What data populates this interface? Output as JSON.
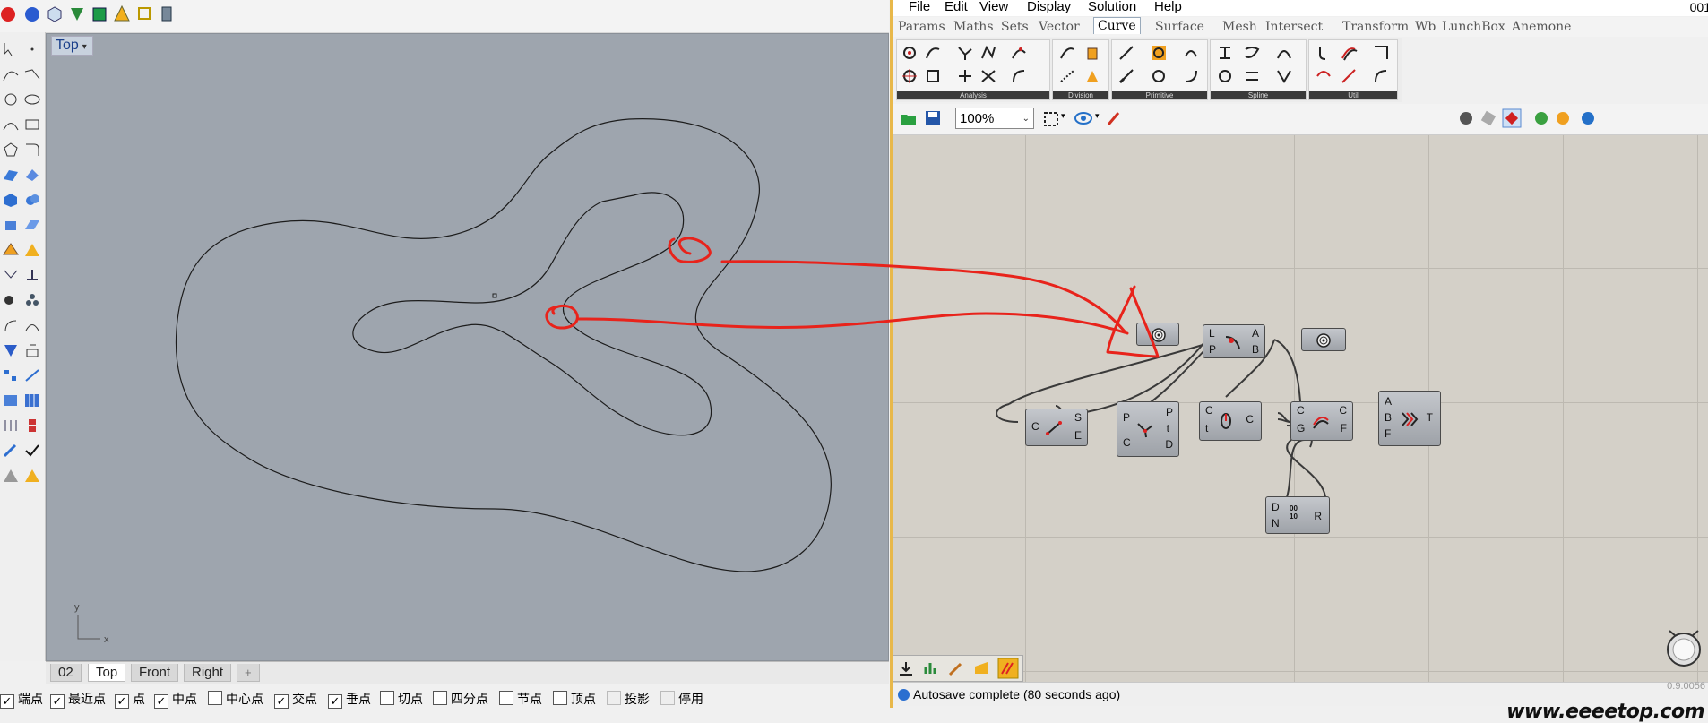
{
  "rhino": {
    "viewport_label": "Top",
    "view_tabs": [
      "02",
      "Top",
      "Front",
      "Right"
    ],
    "active_view_tab": "Top",
    "add_view_tab": "+",
    "osnaps": [
      {
        "label": "端点",
        "checked": true
      },
      {
        "label": "最近点",
        "checked": true
      },
      {
        "label": "点",
        "checked": true
      },
      {
        "label": "中点",
        "checked": true
      },
      {
        "label": "中心点",
        "checked": false
      },
      {
        "label": "交点",
        "checked": true
      },
      {
        "label": "垂点",
        "checked": true
      },
      {
        "label": "切点",
        "checked": false
      },
      {
        "label": "四分点",
        "checked": false
      },
      {
        "label": "节点",
        "checked": false
      },
      {
        "label": "顶点",
        "checked": false
      },
      {
        "label": "投影",
        "checked": false
      },
      {
        "label": "停用",
        "checked": false
      }
    ],
    "axis_x": "x",
    "axis_y": "y"
  },
  "grasshopper": {
    "menus": [
      "File",
      "Edit",
      "View",
      "Display",
      "Solution",
      "Help"
    ],
    "version_label": "001",
    "tabs": [
      "Params",
      "Maths",
      "Sets",
      "Vector",
      "Curve",
      "Surface",
      "Mesh",
      "Intersect",
      "Transform",
      "Wb",
      "LunchBox",
      "Anemone"
    ],
    "active_tab": "Curve",
    "ribbon_groups": [
      "Analysis",
      "Division",
      "Primitive",
      "Spline",
      "Util"
    ],
    "zoom": "100%",
    "status": "Autosave complete (80 seconds ago)",
    "canvas_version": "0.9.0056",
    "nodes": {
      "curve_param_a": {
        "icon": "curve-param-icon"
      },
      "closest_point": {
        "in": [
          "L",
          "P"
        ],
        "out": [
          "A",
          "B"
        ]
      },
      "curve_param_b": {
        "icon": "curve-param-icon"
      },
      "endpoints": {
        "in": [
          "C"
        ],
        "out": [
          "S",
          "E"
        ]
      },
      "curve_closest": {
        "in": [
          "P",
          "C"
        ],
        "out": [
          "P",
          "t",
          "D"
        ]
      },
      "seam": {
        "in": [
          "C",
          "t"
        ],
        "out": [
          "C"
        ]
      },
      "flip": {
        "in": [
          "C",
          "G"
        ],
        "out": [
          "C",
          "F"
        ]
      },
      "tween": {
        "in": [
          "A",
          "B",
          "F"
        ],
        "out": [
          "T"
        ]
      },
      "range": {
        "in": [
          "D",
          "N"
        ],
        "out": [
          "R"
        ],
        "icon_text": "00\n10"
      }
    }
  },
  "watermark": "www.eeeetop.com",
  "colors": {
    "viewport_bg": "#9ea5ae",
    "gh_canvas": "#d4d0c8",
    "annotation_red": "#e8231b",
    "gh_frame": "#e8b84a"
  }
}
